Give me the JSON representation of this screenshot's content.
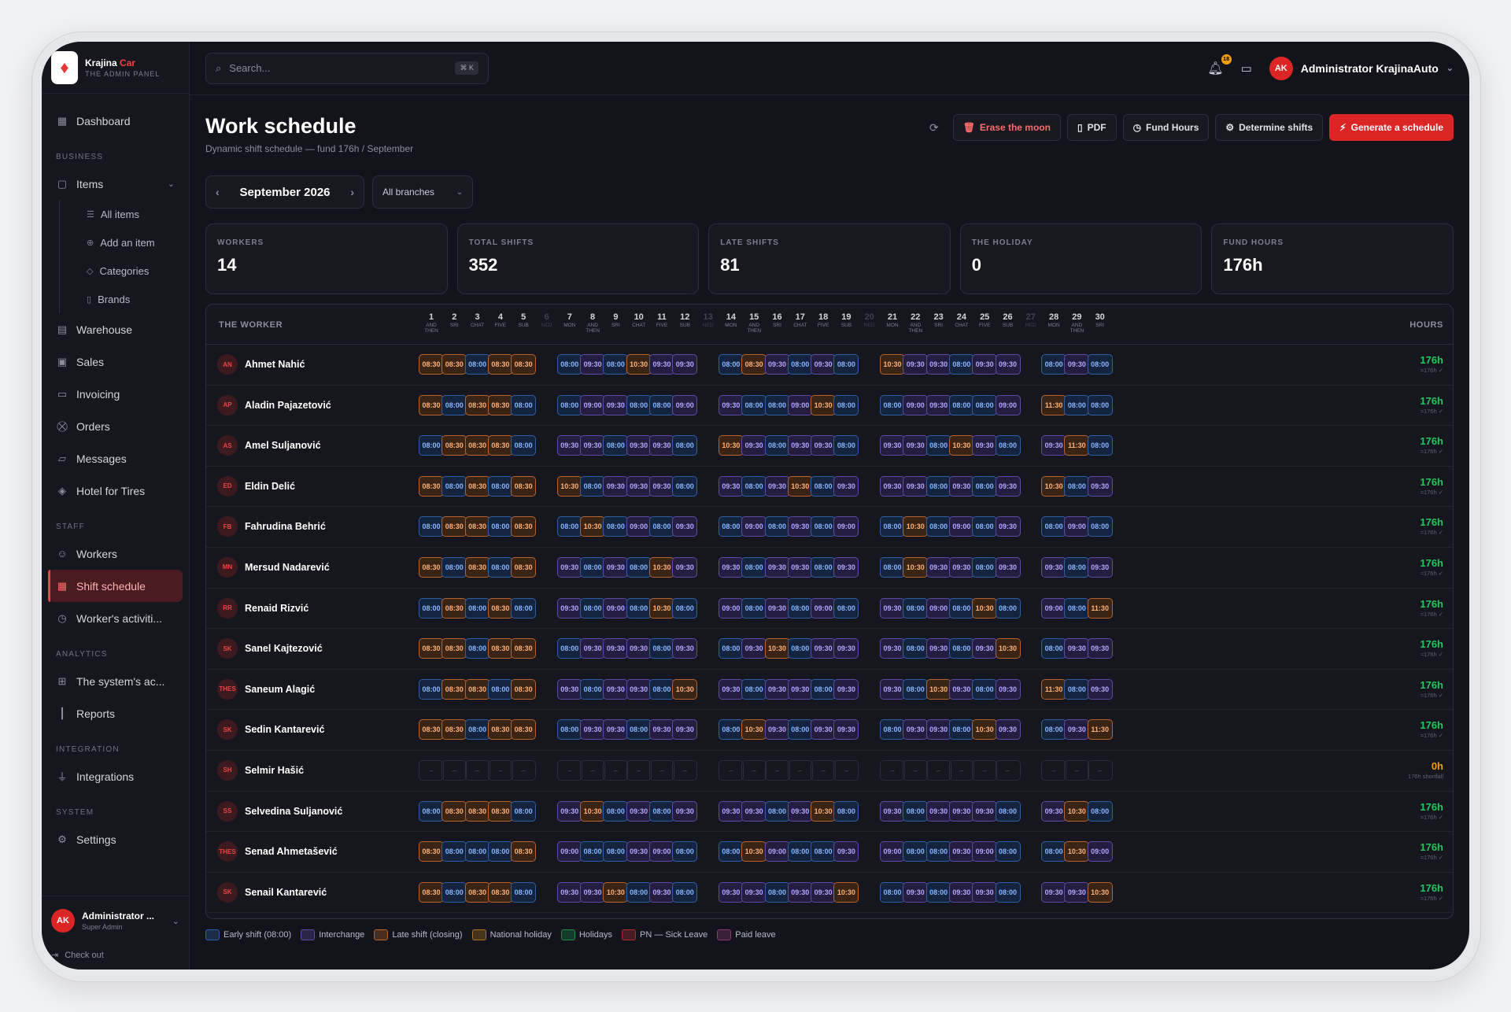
{
  "brand": {
    "name1": "Krajina",
    "name2": "Car",
    "subtitle": "THE ADMIN PANEL"
  },
  "sidebar": {
    "dashboard": "Dashboard",
    "sections": {
      "business": "BUSINESS",
      "staff": "STAFF",
      "analytics": "ANALYTICS",
      "integration": "INTEGRATION",
      "system": "SYSTEM"
    },
    "items": "Items",
    "subitems": [
      "All items",
      "Add an item",
      "Categories",
      "Brands"
    ],
    "business_items": [
      "Warehouse",
      "Sales",
      "Invoicing",
      "Orders",
      "Messages",
      "Hotel for Tires"
    ],
    "staff_items": [
      "Workers",
      "Shift schedule",
      "Worker's activiti..."
    ],
    "analytics_items": [
      "The system's ac...",
      "Reports"
    ],
    "integration_items": [
      "Integrations"
    ],
    "system_items": [
      "Settings"
    ],
    "user": {
      "initials": "AK",
      "name": "Administrator ...",
      "role": "Super Admin"
    },
    "checkout": "Check out"
  },
  "topbar": {
    "search_placeholder": "Search...",
    "kbd": "⌘ K",
    "notif_count": "18",
    "user_initials": "AK",
    "user_name": "Administrator KrajinaAuto"
  },
  "header": {
    "title": "Work schedule",
    "subtitle": "Dynamic shift schedule — fund 176h / September"
  },
  "actions": {
    "erase": "Erase the moon",
    "pdf": "PDF",
    "fund": "Fund Hours",
    "determine": "Determine shifts",
    "generate": "Generate a schedule"
  },
  "period": {
    "month": "September 2026",
    "branch": "All branches"
  },
  "stats": [
    {
      "label": "WORKERS",
      "value": "14"
    },
    {
      "label": "TOTAL SHIFTS",
      "value": "352"
    },
    {
      "label": "LATE SHIFTS",
      "value": "81"
    },
    {
      "label": "THE HOLIDAY",
      "value": "0"
    },
    {
      "label": "FUND HOURS",
      "value": "176h"
    }
  ],
  "table": {
    "worker_header": "THE WORKER",
    "hours_header": "HOURS",
    "days": [
      {
        "n": "1",
        "d": "AND THEN"
      },
      {
        "n": "2",
        "d": "SRI"
      },
      {
        "n": "3",
        "d": "CHAT"
      },
      {
        "n": "4",
        "d": "FIVE"
      },
      {
        "n": "5",
        "d": "SUB"
      },
      {
        "n": "6",
        "d": "NED",
        "empty": true
      },
      {
        "n": "7",
        "d": "MON"
      },
      {
        "n": "8",
        "d": "AND THEN"
      },
      {
        "n": "9",
        "d": "SRI"
      },
      {
        "n": "10",
        "d": "CHAT"
      },
      {
        "n": "11",
        "d": "FIVE"
      },
      {
        "n": "12",
        "d": "SUB"
      },
      {
        "n": "13",
        "d": "NED",
        "empty": true
      },
      {
        "n": "14",
        "d": "MON"
      },
      {
        "n": "15",
        "d": "AND THEN"
      },
      {
        "n": "16",
        "d": "SRI"
      },
      {
        "n": "17",
        "d": "CHAT"
      },
      {
        "n": "18",
        "d": "FIVE"
      },
      {
        "n": "19",
        "d": "SUB"
      },
      {
        "n": "20",
        "d": "NED",
        "empty": true
      },
      {
        "n": "21",
        "d": "MON"
      },
      {
        "n": "22",
        "d": "AND THEN"
      },
      {
        "n": "23",
        "d": "SRI"
      },
      {
        "n": "24",
        "d": "CHAT"
      },
      {
        "n": "25",
        "d": "FIVE"
      },
      {
        "n": "26",
        "d": "SUB"
      },
      {
        "n": "27",
        "d": "NED",
        "empty": true
      },
      {
        "n": "28",
        "d": "MON"
      },
      {
        "n": "29",
        "d": "AND THEN"
      },
      {
        "n": "30",
        "d": "SRI"
      }
    ],
    "rows": [
      {
        "initials": "AN",
        "name": "Ahmet Nahić",
        "hours": "176h",
        "note": "≈176h ✓",
        "shifts": [
          "08:30",
          "08:30",
          "08:00",
          "08:30",
          "08:30",
          "08:00",
          "09:30",
          "08:00",
          "10:30",
          "09:30",
          "09:30",
          "08:00",
          "08:30",
          "09:30",
          "08:00",
          "09:30",
          "08:00",
          "10:30",
          "09:30",
          "09:30",
          "08:00",
          "09:30",
          "09:30",
          "08:00",
          "09:30",
          "08:00"
        ]
      },
      {
        "initials": "AP",
        "name": "Aladin Pajazetović",
        "hours": "176h",
        "note": "≈176h ✓",
        "shifts": [
          "08:30",
          "08:00",
          "08:30",
          "08:30",
          "08:00",
          "08:00",
          "09:00",
          "09:30",
          "08:00",
          "08:00",
          "09:00",
          "09:30",
          "08:00",
          "08:00",
          "09:00",
          "10:30",
          "08:00",
          "08:00",
          "09:00",
          "09:30",
          "08:00",
          "08:00",
          "09:00",
          "11:30",
          "08:00",
          "08:00"
        ]
      },
      {
        "initials": "AS",
        "name": "Amel Suljanović",
        "hours": "176h",
        "note": "≈176h ✓",
        "shifts": [
          "08:00",
          "08:30",
          "08:30",
          "08:30",
          "08:00",
          "09:30",
          "09:30",
          "08:00",
          "09:30",
          "09:30",
          "08:00",
          "10:30",
          "09:30",
          "08:00",
          "09:30",
          "09:30",
          "08:00",
          "09:30",
          "09:30",
          "08:00",
          "10:30",
          "09:30",
          "08:00",
          "09:30",
          "11:30",
          "08:00"
        ]
      },
      {
        "initials": "ED",
        "name": "Eldin Delić",
        "hours": "176h",
        "note": "≈176h ✓",
        "shifts": [
          "08:30",
          "08:00",
          "08:30",
          "08:00",
          "08:30",
          "10:30",
          "08:00",
          "09:30",
          "09:30",
          "09:30",
          "08:00",
          "09:30",
          "08:00",
          "09:30",
          "10:30",
          "08:00",
          "09:30",
          "09:30",
          "09:30",
          "08:00",
          "09:30",
          "08:00",
          "09:30",
          "10:30",
          "08:00",
          "09:30"
        ]
      },
      {
        "initials": "FB",
        "name": "Fahrudina Behrić",
        "hours": "176h",
        "note": "≈176h ✓",
        "shifts": [
          "08:00",
          "08:30",
          "08:30",
          "08:00",
          "08:30",
          "08:00",
          "10:30",
          "08:00",
          "09:00",
          "08:00",
          "09:30",
          "08:00",
          "09:00",
          "08:00",
          "09:30",
          "08:00",
          "09:00",
          "08:00",
          "10:30",
          "08:00",
          "09:00",
          "08:00",
          "09:30",
          "08:00",
          "09:00",
          "08:00"
        ]
      },
      {
        "initials": "MN",
        "name": "Mersud Nadarević",
        "hours": "176h",
        "note": "≈176h ✓",
        "shifts": [
          "08:30",
          "08:00",
          "08:30",
          "08:00",
          "08:30",
          "09:30",
          "08:00",
          "09:30",
          "08:00",
          "10:30",
          "09:30",
          "09:30",
          "08:00",
          "09:30",
          "09:30",
          "08:00",
          "09:30",
          "08:00",
          "10:30",
          "09:30",
          "09:30",
          "08:00",
          "09:30",
          "09:30",
          "08:00",
          "09:30"
        ]
      },
      {
        "initials": "RR",
        "name": "Renaid Rizvić",
        "hours": "176h",
        "note": "≈176h ✓",
        "shifts": [
          "08:00",
          "08:30",
          "08:00",
          "08:30",
          "08:00",
          "09:30",
          "08:00",
          "09:00",
          "08:00",
          "10:30",
          "08:00",
          "09:00",
          "08:00",
          "09:30",
          "08:00",
          "09:00",
          "08:00",
          "09:30",
          "08:00",
          "09:00",
          "08:00",
          "10:30",
          "08:00",
          "09:00",
          "08:00",
          "11:30"
        ]
      },
      {
        "initials": "SK",
        "name": "Sanel Kajtezović",
        "hours": "176h",
        "note": "≈176h ✓",
        "shifts": [
          "08:30",
          "08:30",
          "08:00",
          "08:30",
          "08:30",
          "08:00",
          "09:30",
          "09:30",
          "09:30",
          "08:00",
          "09:30",
          "08:00",
          "09:30",
          "10:30",
          "08:00",
          "09:30",
          "09:30",
          "09:30",
          "08:00",
          "09:30",
          "08:00",
          "09:30",
          "10:30",
          "08:00",
          "09:30",
          "09:30"
        ]
      },
      {
        "initials": "THES",
        "name": "Saneum Alagić",
        "hours": "176h",
        "note": "≈176h ✓",
        "shifts": [
          "08:00",
          "08:30",
          "08:30",
          "08:00",
          "08:30",
          "09:30",
          "08:00",
          "09:30",
          "09:30",
          "08:00",
          "10:30",
          "09:30",
          "08:00",
          "09:30",
          "09:30",
          "08:00",
          "09:30",
          "09:30",
          "08:00",
          "10:30",
          "09:30",
          "08:00",
          "09:30",
          "11:30",
          "08:00",
          "09:30"
        ]
      },
      {
        "initials": "SK",
        "name": "Sedin Kantarević",
        "hours": "176h",
        "note": "≈176h ✓",
        "shifts": [
          "08:30",
          "08:30",
          "08:00",
          "08:30",
          "08:30",
          "08:00",
          "09:30",
          "09:30",
          "08:00",
          "09:30",
          "09:30",
          "08:00",
          "10:30",
          "09:30",
          "08:00",
          "09:30",
          "09:30",
          "08:00",
          "09:30",
          "09:30",
          "08:00",
          "10:30",
          "09:30",
          "08:00",
          "09:30",
          "11:30"
        ]
      },
      {
        "initials": "SH",
        "name": "Selmir Hašić",
        "hours": "0h",
        "note": "176h shortfall",
        "warn": true,
        "shifts": [
          "–",
          "–",
          "–",
          "–",
          "–",
          "–",
          "–",
          "–",
          "–",
          "–",
          "–",
          "–",
          "–",
          "–",
          "–",
          "–",
          "–",
          "–",
          "–",
          "–",
          "–",
          "–",
          "–",
          "–",
          "–",
          "–"
        ]
      },
      {
        "initials": "SS",
        "name": "Selvedina Suljanović",
        "hours": "176h",
        "note": "≈176h ✓",
        "shifts": [
          "08:00",
          "08:30",
          "08:30",
          "08:30",
          "08:00",
          "09:30",
          "10:30",
          "08:00",
          "09:30",
          "08:00",
          "09:30",
          "09:30",
          "09:30",
          "08:00",
          "09:30",
          "10:30",
          "08:00",
          "09:30",
          "08:00",
          "09:30",
          "09:30",
          "09:30",
          "08:00",
          "09:30",
          "10:30",
          "08:00"
        ]
      },
      {
        "initials": "THES",
        "name": "Senad Ahmetašević",
        "hours": "176h",
        "note": "≈176h ✓",
        "shifts": [
          "08:30",
          "08:00",
          "08:00",
          "08:00",
          "08:30",
          "09:00",
          "08:00",
          "08:00",
          "09:30",
          "09:00",
          "08:00",
          "08:00",
          "10:30",
          "09:00",
          "08:00",
          "08:00",
          "09:30",
          "09:00",
          "08:00",
          "08:00",
          "09:30",
          "09:00",
          "08:00",
          "08:00",
          "10:30",
          "09:00"
        ]
      },
      {
        "initials": "SK",
        "name": "Senail Kantarević",
        "hours": "176h",
        "note": "≈176h ✓",
        "shifts": [
          "08:30",
          "08:00",
          "08:30",
          "08:30",
          "08:00",
          "09:30",
          "09:30",
          "10:30",
          "08:00",
          "09:30",
          "08:00",
          "09:30",
          "09:30",
          "08:00",
          "09:30",
          "09:30",
          "10:30",
          "08:00",
          "09:30",
          "08:00",
          "09:30",
          "09:30",
          "08:00",
          "09:30",
          "09:30",
          "10:30"
        ]
      }
    ]
  },
  "legend": [
    {
      "label": "Early shift (08:00)",
      "color": "#2f5ea8"
    },
    {
      "label": "Interchange",
      "color": "#5b4aa8"
    },
    {
      "label": "Late shift (closing)",
      "color": "#b8632b"
    },
    {
      "label": "National holiday",
      "color": "#a8741f"
    },
    {
      "label": "Holidays",
      "color": "#1f8a4a"
    },
    {
      "label": "PN — Sick Leave",
      "color": "#a83232"
    },
    {
      "label": "Paid leave",
      "color": "#8a3a6e"
    }
  ]
}
